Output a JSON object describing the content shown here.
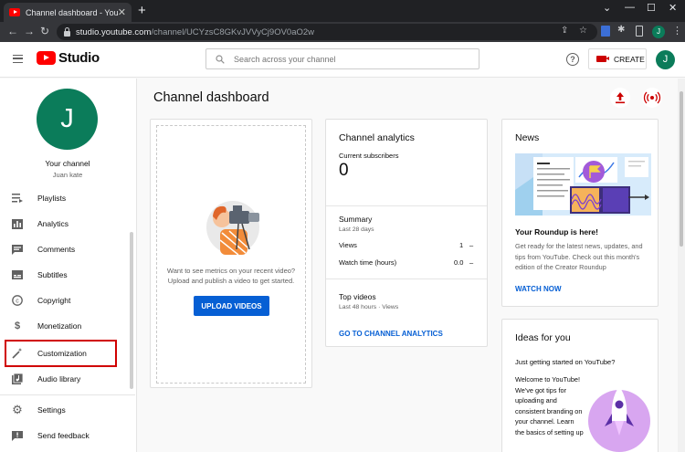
{
  "browser": {
    "tab_title": "Channel dashboard - YouTube Studio",
    "url_host": "studio.youtube.com",
    "url_path": "/channel/UCYzsC8GKvJVVyCj9OV0aO2w",
    "profile_initial": "J"
  },
  "header": {
    "logo_text": "Studio",
    "search_placeholder": "Search across your channel",
    "create_label": "CREATE",
    "avatar_initial": "J"
  },
  "sidebar": {
    "avatar_initial": "J",
    "your_channel": "Your channel",
    "channel_name": "Juan kate",
    "items": [
      {
        "label": "Playlists",
        "icon": "playlists-icon"
      },
      {
        "label": "Analytics",
        "icon": "analytics-icon"
      },
      {
        "label": "Comments",
        "icon": "comments-icon"
      },
      {
        "label": "Subtitles",
        "icon": "subtitles-icon"
      },
      {
        "label": "Copyright",
        "icon": "copyright-icon"
      },
      {
        "label": "Monetization",
        "icon": "monetization-icon"
      },
      {
        "label": "Customization",
        "icon": "magic-wand-icon"
      },
      {
        "label": "Audio library",
        "icon": "audio-library-icon"
      },
      {
        "label": "Settings",
        "icon": "gear-icon"
      },
      {
        "label": "Send feedback",
        "icon": "feedback-icon"
      }
    ]
  },
  "main": {
    "title": "Channel dashboard",
    "upload_card": {
      "prompt": "Want to see metrics on your recent video? Upload and publish a video to get started.",
      "button": "UPLOAD VIDEOS"
    },
    "analytics": {
      "title": "Channel analytics",
      "subs_label": "Current subscribers",
      "subs_value": "0",
      "summary_title": "Summary",
      "summary_period": "Last 28 days",
      "views_label": "Views",
      "views_value": "1",
      "watch_label": "Watch time (hours)",
      "watch_value": "0.0",
      "top_videos_title": "Top videos",
      "top_videos_sub": "Last 48 hours · Views",
      "link": "GO TO CHANNEL ANALYTICS"
    },
    "news": {
      "title": "News",
      "headline": "Your Roundup is here!",
      "body": "Get ready for the latest news, updates, and tips from YouTube. Check out this month's edition of the Creator Roundup",
      "link": "WATCH NOW"
    },
    "ideas": {
      "title": "Ideas for you",
      "subtitle": "Just getting started on YouTube?",
      "body": "Welcome to YouTube! We've got tips for uploading and consistent branding on your channel. Learn the basics of setting up"
    }
  },
  "colors": {
    "brand_red": "#ff0000",
    "link_blue": "#065fd4",
    "avatar_green": "#0b7c5a",
    "highlight_red": "#d00000"
  }
}
